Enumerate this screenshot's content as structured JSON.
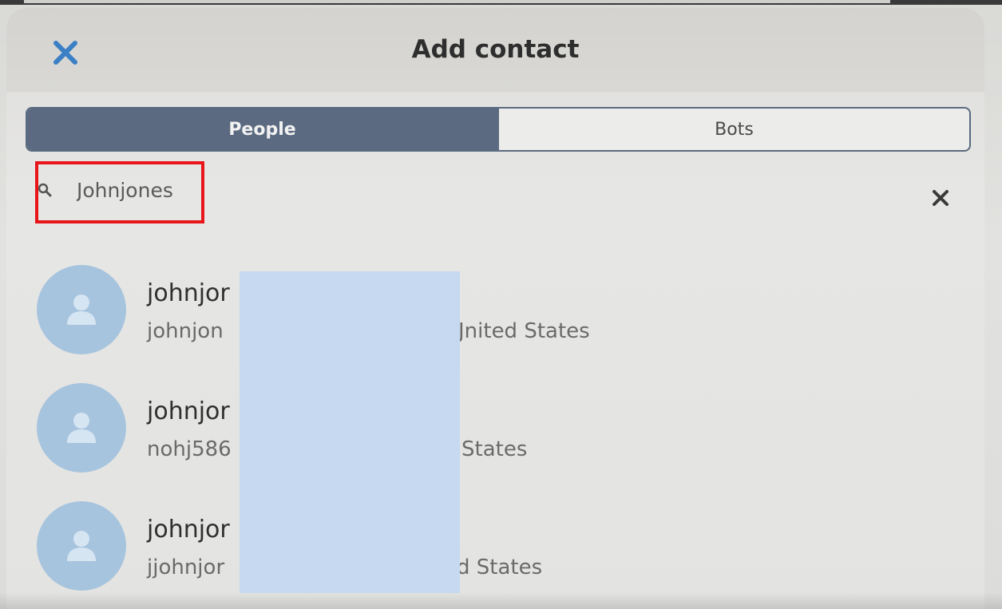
{
  "dialog": {
    "title": "Add contact",
    "close_icon": "close-icon"
  },
  "tabs": [
    {
      "label": "People",
      "active": true
    },
    {
      "label": "Bots",
      "active": false
    }
  ],
  "search": {
    "value": "Johnjones",
    "icon": "search-icon",
    "clear_icon": "clear-icon"
  },
  "results": [
    {
      "name": "johnjor",
      "detail": "johnjon",
      "detail_tail": "Jnited States"
    },
    {
      "name": "johnjor",
      "detail": "nohj586",
      "detail_tail": "States"
    },
    {
      "name": "johnjor",
      "detail": "jjohnjor",
      "detail_tail": "ed States"
    }
  ],
  "colors": {
    "accent": "#3b7fc4",
    "tab_active": "#5b6a80",
    "avatar": "#a7c4de",
    "highlight": "#e8161b",
    "redaction": "#c6d9f0"
  }
}
